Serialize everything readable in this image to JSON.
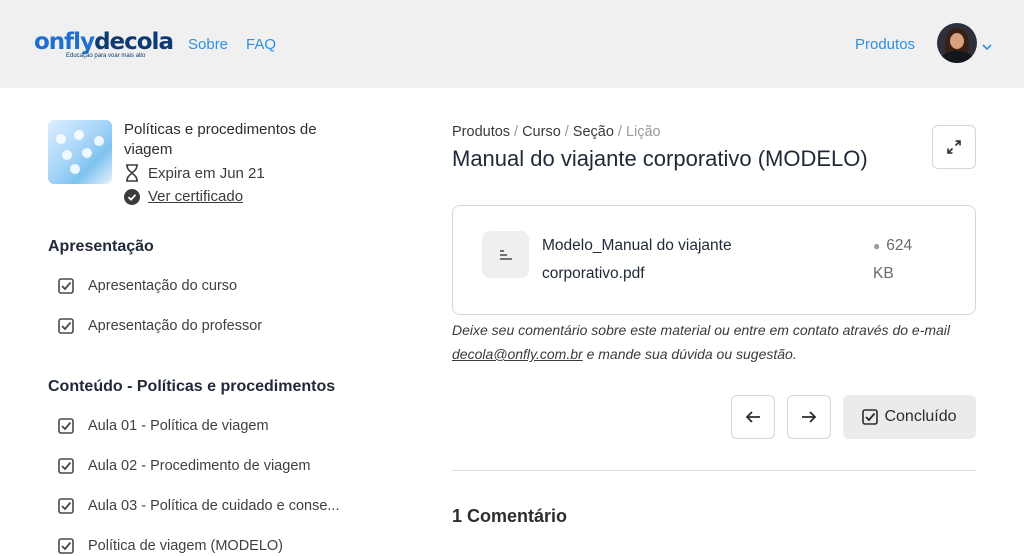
{
  "header": {
    "logo": {
      "part1": "onfly",
      "part2": "decola",
      "tagline": "Educação para voar mais alto"
    },
    "nav": {
      "sobre": "Sobre",
      "faq": "FAQ",
      "produtos": "Produtos"
    },
    "colors": {
      "brand_blue": "#1f6fd1",
      "brand_dark": "#0b3a74",
      "link": "#2f8fe5"
    }
  },
  "course": {
    "title": "Políticas e procedimentos de viagem",
    "expires": "Expira em Jun 21",
    "certificate_link": "Ver certificado"
  },
  "sections": [
    {
      "title": "Apresentação",
      "lessons": [
        "Apresentação do curso",
        "Apresentação do professor"
      ]
    },
    {
      "title": "Conteúdo - Políticas e procedimentos",
      "lessons": [
        "Aula 01 - Política de viagem",
        "Aula 02 - Procedimento de viagem",
        "Aula 03 - Política de cuidado e conse...",
        "Política de viagem (MODELO)"
      ]
    }
  ],
  "breadcrumb": {
    "produtos": "Produtos",
    "curso": "Curso",
    "secao": "Seção",
    "licao": "Lição",
    "separator": "/"
  },
  "lesson": {
    "title": "Manual do viajante corporativo (MODELO)",
    "file": {
      "name": "Modelo_Manual do viajante corporativo.pdf",
      "size_value": "624",
      "size_unit": "KB"
    },
    "note_before": "Deixe seu comentário sobre este material ou entre em contato através do e-mail ",
    "note_email": "decola@onfly.com.br",
    "note_after": " e mande sua dúvida ou sugestão."
  },
  "controls": {
    "done_label": "Concluído"
  },
  "comments": {
    "title": "1 Comentário"
  }
}
